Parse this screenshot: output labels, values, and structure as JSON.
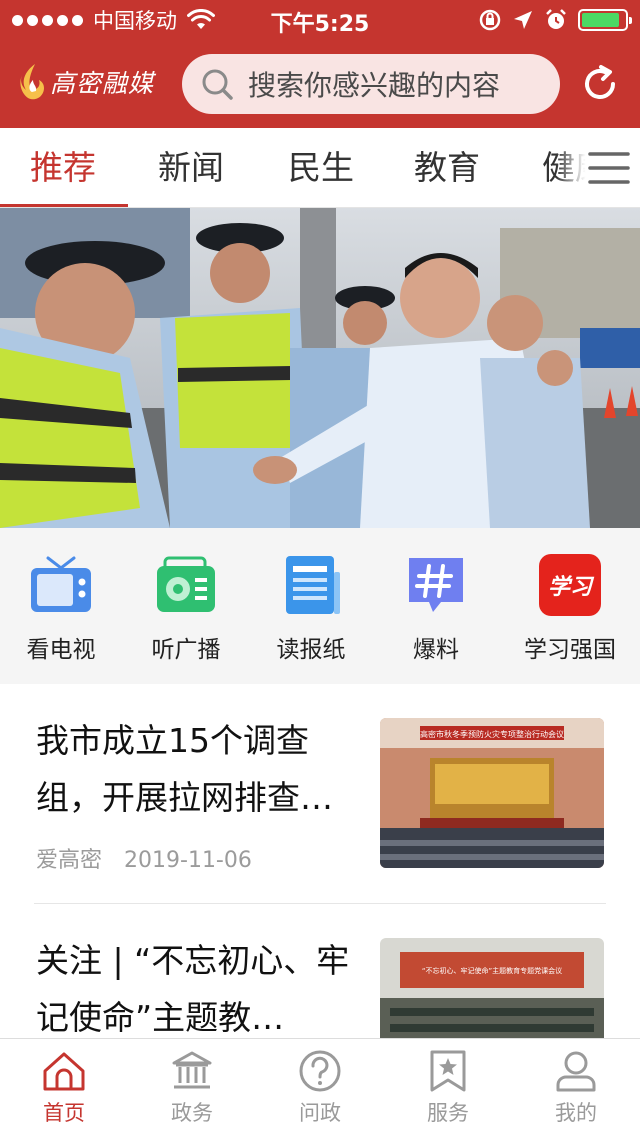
{
  "status_bar": {
    "carrier": "中国移动",
    "time": "下午5:25",
    "battery_level": 0.9
  },
  "header": {
    "logo_text": "高密融媒",
    "search_placeholder": "搜索你感兴趣的内容",
    "icons": [
      "search-icon",
      "refresh-icon"
    ]
  },
  "tabs": [
    {
      "label": "推荐",
      "active": true
    },
    {
      "label": "新闻",
      "active": false
    },
    {
      "label": "民生",
      "active": false
    },
    {
      "label": "教育",
      "active": false
    },
    {
      "label": "健康",
      "active": false
    }
  ],
  "quick_links": [
    {
      "label": "看电视",
      "icon": "tv-icon"
    },
    {
      "label": "听广播",
      "icon": "radio-icon"
    },
    {
      "label": "读报纸",
      "icon": "newspaper-icon"
    },
    {
      "label": "爆料",
      "icon": "hashtag-icon"
    },
    {
      "label": "学习强国",
      "icon": "xuexi-logo-icon"
    }
  ],
  "xuexi_logo_text": "学习",
  "news": [
    {
      "title": "我市成立15个调查组，开展拉网排查…",
      "source": "爱高密",
      "date": "2019-11-06",
      "thumb_banner": "高密市秋冬季预防火灾专项整治行动会议"
    },
    {
      "title": "关注 | “不忘初心、牢记使命”主题教…",
      "source": "",
      "date": "",
      "thumb_banner": "“不忘初心、牢记使命”主题教育专题党课会议"
    }
  ],
  "bottom_nav": [
    {
      "label": "首页",
      "icon": "home-icon",
      "active": true
    },
    {
      "label": "政务",
      "icon": "government-building-icon",
      "active": false
    },
    {
      "label": "问政",
      "icon": "question-icon",
      "active": false
    },
    {
      "label": "服务",
      "icon": "bookmark-star-icon",
      "active": false
    },
    {
      "label": "我的",
      "icon": "user-icon",
      "active": false
    }
  ],
  "colors": {
    "brand_red": "#c5352f",
    "search_bg": "#f9e4e3",
    "inactive_gray": "#9a9a9a"
  }
}
